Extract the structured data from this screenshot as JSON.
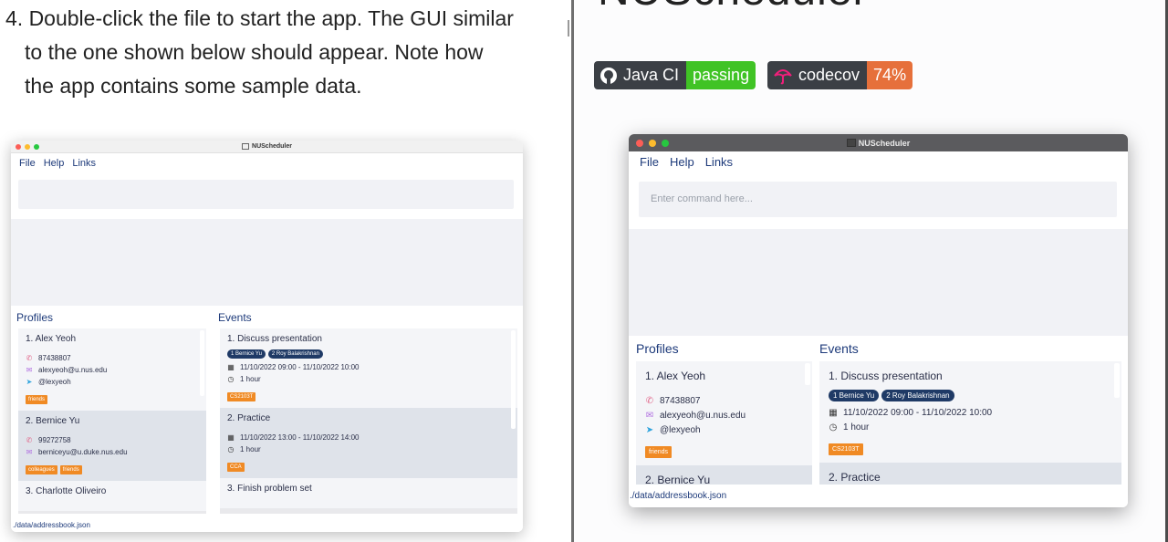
{
  "doc": {
    "step_lines": [
      "4. Double-click the file to start the app. The GUI similar",
      "to the one shown below should appear. Note how",
      "the app contains some sample data."
    ],
    "heading_partial": "NUScheduler"
  },
  "badges": {
    "ci": {
      "label": "Java CI",
      "value": "passing",
      "color": "#40c325",
      "icon": "github-icon"
    },
    "coverage": {
      "label": "codecov",
      "value": "74%",
      "color": "#e6703b",
      "icon": "umbrella-icon"
    }
  },
  "app": {
    "title": "NUScheduler",
    "menu": [
      "File",
      "Help",
      "Links"
    ],
    "command_placeholder": "Enter command here...",
    "profiles_title": "Profiles",
    "events_title": "Events",
    "status_path": "./data/addressbook.json",
    "profiles": [
      {
        "name": "1.  Alex Yeoh",
        "phone": "87438807",
        "email": "alexyeoh@u.nus.edu",
        "telegram": "@lexyeoh",
        "tags": [
          "friends"
        ]
      },
      {
        "name": "2.  Bernice Yu",
        "phone": "99272758",
        "email": "berniceyu@u.duke.nus.edu",
        "tags": [
          "colleagues",
          "friends"
        ]
      },
      {
        "name": "3.  Charlotte Oliveiro"
      }
    ],
    "events": [
      {
        "title": "1.  Discuss presentation",
        "attendees": [
          "1 Bernice Yu",
          "2 Roy Balakrishnan"
        ],
        "time": "11/10/2022 09:00 - 11/10/2022 10:00",
        "duration": "1 hour",
        "tags": [
          "CS2103T"
        ]
      },
      {
        "title": "2.  Practice",
        "time": "11/10/2022 13:00 - 11/10/2022 14:00",
        "duration": "1 hour",
        "tags": [
          "CCA"
        ]
      },
      {
        "title": "3.  Finish problem set"
      }
    ],
    "right_partial_profile": "2.  Bernice Yu",
    "right_partial_event": "2.  Practice"
  },
  "colors": {
    "accent_text": "#1d3a7a",
    "tag_orange": "#f08a24",
    "pill_navy": "#1f3a66"
  }
}
